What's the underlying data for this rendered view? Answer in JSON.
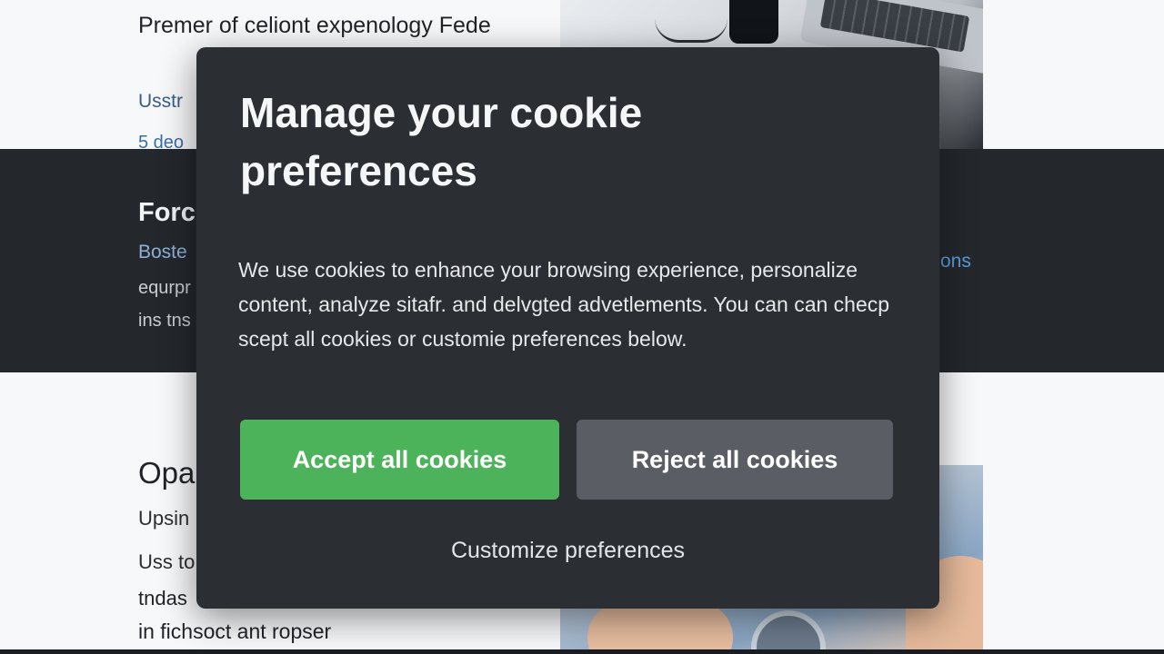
{
  "background_page": {
    "top_section": {
      "title": "Premer of celiont expenology Fede",
      "link1": "Usstr",
      "link2": "5 deo"
    },
    "dark_section": {
      "title": "Forc",
      "subtitle": "Boste",
      "line1": "equrpr",
      "line2": "ins tns",
      "right_link": "ons"
    },
    "bottom_section": {
      "title": "Opa",
      "subtitle": "Upsin",
      "line1": "Uss to",
      "line2": "tndas",
      "line3": "in fichsoct ant  ropser"
    }
  },
  "cookie_modal": {
    "title": "Manage your cookie preferences",
    "body": "We use cookies to enhance your browsing experience, personalize content, analyze sitafr. and delvgted advetlements. You can can checp scept all cookies or customie preferences below.",
    "accept_label": "Accept all cookies",
    "reject_label": "Reject all cookies",
    "customize_label": "Customize preferences",
    "colors": {
      "background": "#2b2e32",
      "accept": "#4cb35a",
      "reject": "#5a5e64"
    }
  }
}
